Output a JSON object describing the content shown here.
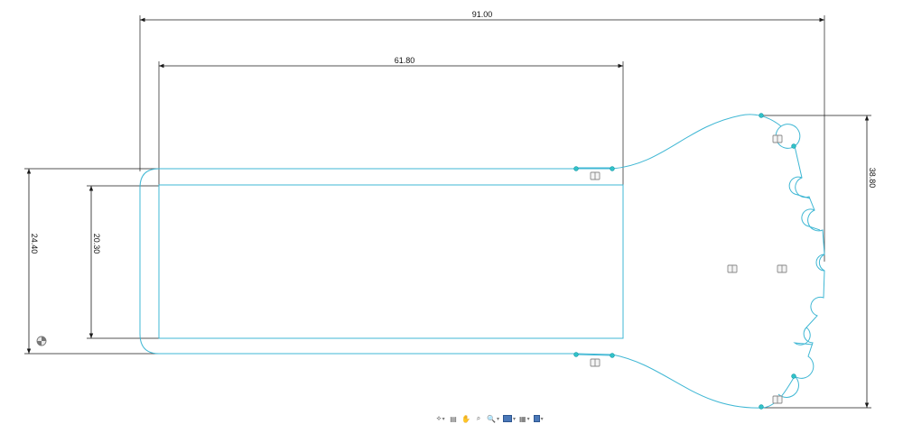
{
  "dimensions": {
    "overall_length": "91.00",
    "inner_length": "61.80",
    "outer_height": "24.40",
    "inner_height": "20.30",
    "head_height": "38.80"
  },
  "colors": {
    "profile": "#3fb7d4",
    "vertex": "#31c2c8",
    "dimension": "#1a1a1a"
  },
  "toolbar": {
    "items": [
      {
        "icon": "view-orientation-icon",
        "glyph": "⟡",
        "has_menu": true
      },
      {
        "icon": "print-icon",
        "glyph": "▤",
        "has_menu": false
      },
      {
        "icon": "pan-hand-icon",
        "glyph": "✋",
        "has_menu": false
      },
      {
        "icon": "zoom-window-icon",
        "glyph": "⌕",
        "has_menu": false
      },
      {
        "icon": "zoom-icon",
        "glyph": "🔍",
        "has_menu": true
      },
      {
        "icon": "display-style-icon",
        "glyph": "",
        "has_menu": true
      },
      {
        "icon": "grid-icon",
        "glyph": "▦",
        "has_menu": true
      },
      {
        "icon": "section-view-icon",
        "glyph": "",
        "has_menu": true
      }
    ]
  }
}
